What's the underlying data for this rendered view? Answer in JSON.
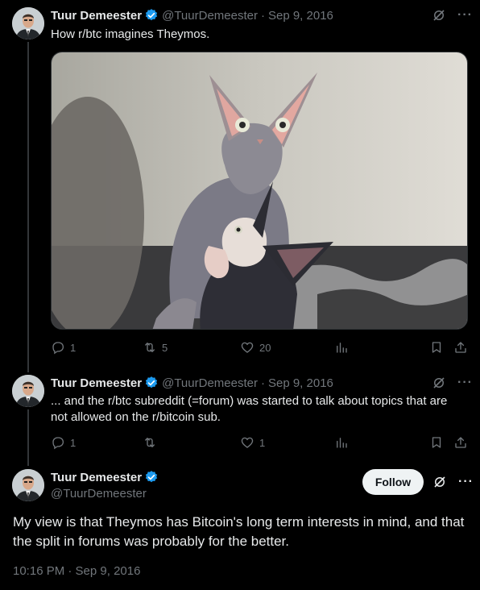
{
  "tweets": [
    {
      "name": "Tuur Demeester",
      "handle": "@TuurDemeester",
      "separator": "·",
      "date": "Sep 9, 2016",
      "text": "How r/btc imagines Theymos.",
      "replies": "1",
      "reposts": "5",
      "likes": "20"
    },
    {
      "name": "Tuur Demeester",
      "handle": "@TuurDemeester",
      "separator": "·",
      "date": "Sep 9, 2016",
      "text_line1": "... and the r/btc subreddit (=forum) was started to talk about topics that are",
      "text_line2": "not allowed on the r/bitcoin sub.",
      "replies": "1",
      "reposts": "",
      "likes": "1"
    }
  ],
  "main_tweet": {
    "name": "Tuur Demeester",
    "handle": "@TuurDemeester",
    "follow_label": "Follow",
    "text": "My view is that Theymos has Bitcoin's long term interests in mind, and that the split in forums was probably for the better.",
    "timestamp": "10:16 PM · Sep 9, 2016"
  },
  "icons": {
    "verified": "verified-badge-icon",
    "grok": "grok-icon",
    "more": "more-icon",
    "reply": "reply-icon",
    "repost": "repost-icon",
    "like": "like-icon",
    "views": "views-icon",
    "bookmark": "bookmark-icon",
    "share": "share-icon"
  },
  "colors": {
    "background": "#000000",
    "text": "#e7e9ea",
    "muted": "#71767b",
    "verified": "#1d9bf0",
    "follow_bg": "#eff3f4"
  }
}
